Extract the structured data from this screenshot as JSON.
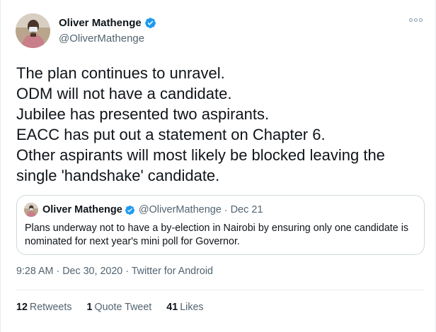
{
  "tweet": {
    "author": {
      "display_name": "Oliver Mathenge",
      "handle": "@OliverMathenge",
      "verified": true
    },
    "more_icon": "more-options-icon",
    "text_lines": [
      "The plan continues to unravel.",
      "ODM will not have a candidate.",
      "Jubilee has presented two aspirants.",
      "EACC has put out a statement on Chapter 6.",
      "Other aspirants will most likely be blocked leaving the",
      "single 'handshake' candidate."
    ],
    "quoted": {
      "display_name": "Oliver Mathenge",
      "handle": "@OliverMathenge",
      "separator": "·",
      "date": "Dec 21",
      "text": "Plans underway not to have a by-election in Nairobi by ensuring only one candidate is nominated for next year's mini poll for Governor."
    },
    "meta": {
      "time": "9:28 AM",
      "sep1": "·",
      "date": "Dec 30, 2020",
      "sep2": "·",
      "source": "Twitter for Android"
    },
    "stats": {
      "retweets_count": "12",
      "retweets_label": "Retweets",
      "quotes_count": "1",
      "quotes_label": "Quote Tweet",
      "likes_count": "41",
      "likes_label": "Likes"
    }
  },
  "colors": {
    "text": "#0f1419",
    "secondary": "#536471",
    "verified_blue": "#1d9bf0",
    "border": "#cfd9de"
  }
}
